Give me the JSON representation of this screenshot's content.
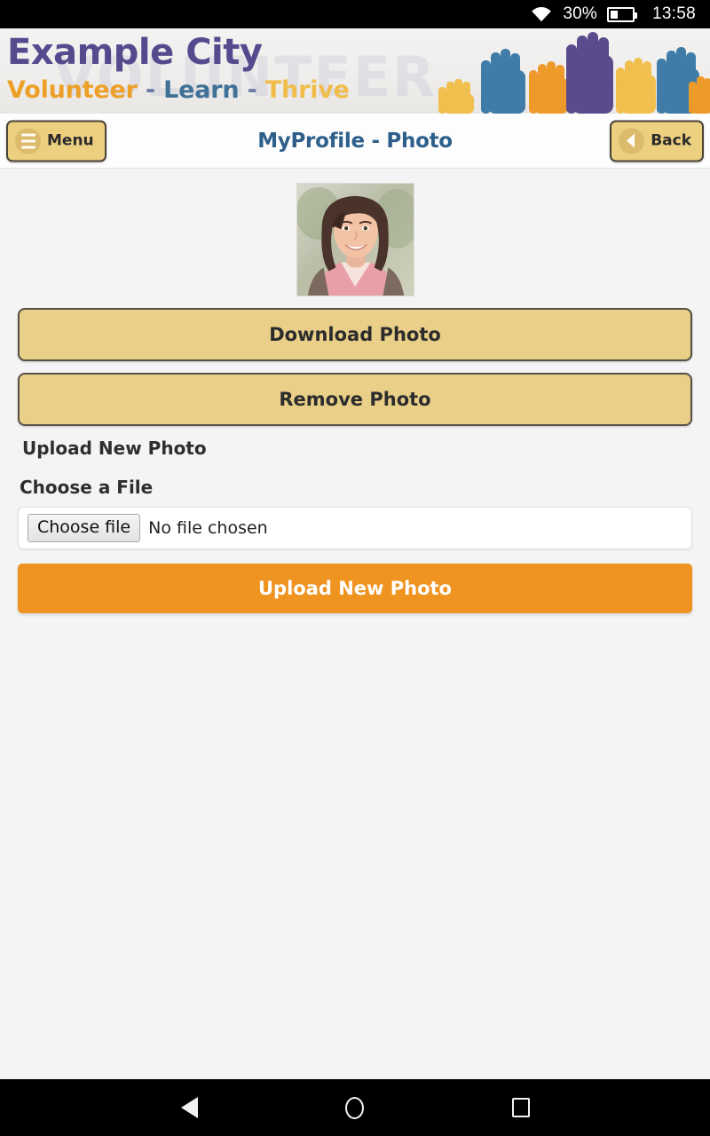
{
  "status_bar": {
    "wifi_icon": "wifi-icon",
    "battery_percent": "30%",
    "battery_icon": "battery-icon",
    "battery_level": 30,
    "time": "13:58"
  },
  "banner": {
    "org_name": "Example City",
    "ghost_text": "VOLUNTEER",
    "tagline": {
      "word1": "Volunteer",
      "sep1": "-",
      "word2": "Learn",
      "sep2": "-",
      "word3": "Thrive"
    },
    "graphic": "raised-hands-illustration",
    "colors": {
      "org_name": "#564a8e",
      "volunteer": "#eda028",
      "learn": "#3f7096",
      "thrive": "#f0bd4a"
    }
  },
  "navbar": {
    "menu_label": "Menu",
    "menu_icon": "hamburger-icon",
    "title": "MyProfile - Photo",
    "title_color": "#2d5f8a",
    "back_label": "Back",
    "back_icon": "chevron-left-icon"
  },
  "main": {
    "profile_photo": "profile-photo-woman-smiling",
    "download_photo_label": "Download Photo",
    "remove_photo_label": "Remove Photo",
    "upload_section_heading": "Upload New Photo",
    "choose_file_label": "Choose a File",
    "file_input": {
      "button_label": "Choose file",
      "status_text": "No file chosen",
      "value": ""
    },
    "upload_button_label": "Upload New Photo",
    "colors": {
      "action_button": "#e9cf87",
      "upload_button": "#ef9421",
      "page_background": "#f4f4f4"
    }
  },
  "android_nav": {
    "back": "android-back-icon",
    "home": "android-home-icon",
    "recent": "android-recents-icon"
  }
}
